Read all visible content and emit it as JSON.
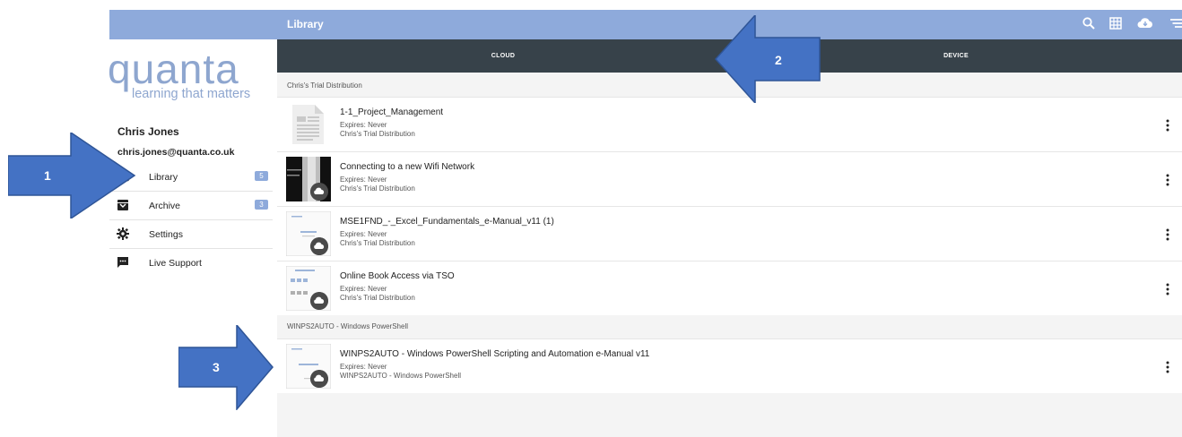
{
  "sidebar": {
    "logo_word": "quanta",
    "logo_tagline": "learning that matters",
    "user_name": "Chris Jones",
    "user_email": "chris.jones@quanta.co.uk",
    "items": [
      {
        "label": "Library",
        "badge": "5",
        "icon": "book-open-icon"
      },
      {
        "label": "Archive",
        "badge": "3",
        "icon": "archive-box-icon"
      },
      {
        "label": "Settings",
        "badge": "",
        "icon": "gear-icon"
      },
      {
        "label": "Live Support",
        "badge": "",
        "icon": "chat-icon"
      }
    ]
  },
  "header": {
    "title": "Library",
    "icons": [
      "search-icon",
      "grid-view-icon",
      "cloud-download-icon",
      "filter-icon"
    ]
  },
  "tabs": [
    {
      "label": "CLOUD"
    },
    {
      "label": "DEVICE"
    }
  ],
  "sections": [
    {
      "heading": "Chris's Trial Distribution",
      "items": [
        {
          "title": "1-1_Project_Management",
          "expires": "Expires: Never",
          "distribution": "Chris's Trial Distribution"
        },
        {
          "title": "Connecting to a new Wifi Network",
          "expires": "Expires: Never",
          "distribution": "Chris's Trial Distribution"
        },
        {
          "title": "MSE1FND_-_Excel_Fundamentals_e-Manual_v11 (1)",
          "expires": "Expires: Never",
          "distribution": "Chris's Trial Distribution"
        },
        {
          "title": "Online Book Access via TSO",
          "expires": "Expires: Never",
          "distribution": "Chris's Trial Distribution"
        }
      ]
    },
    {
      "heading": "WINPS2AUTO - Windows PowerShell",
      "items": [
        {
          "title": "WINPS2AUTO - Windows PowerShell Scripting and Automation e-Manual v11",
          "expires": "Expires: Never",
          "distribution": "WINPS2AUTO - Windows PowerShell"
        }
      ]
    }
  ],
  "annotations": [
    "1",
    "2",
    "3"
  ],
  "colors": {
    "accent": "#8eaadb",
    "tabbar": "#37424a",
    "callout": "#4472c4",
    "background": "#f4f4f4"
  }
}
